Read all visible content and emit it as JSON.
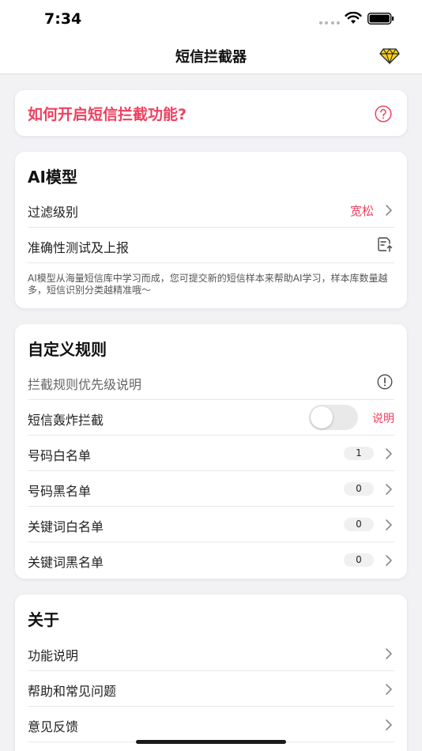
{
  "status_bar": {
    "time": "7:34"
  },
  "navbar": {
    "title": "短信拦截器",
    "premium_icon": "diamond-icon"
  },
  "banner": {
    "text": "如何开启短信拦截功能?",
    "icon": "question-circle-icon"
  },
  "ai_section": {
    "title": "AI模型",
    "rows": [
      {
        "label": "过滤级别",
        "value": "宽松"
      },
      {
        "label": "准确性测试及上报",
        "icon": "report-upload-icon"
      }
    ],
    "note": "AI模型从海量短信库中学习而成，您可提交新的短信样本来帮助AI学习，样本库数量越多，短信识别分类越精准哦～"
  },
  "custom_section": {
    "title": "自定义规则",
    "rows": [
      {
        "label": "拦截规则优先级说明",
        "icon": "info-circle-icon"
      },
      {
        "label": "短信轰炸拦截",
        "toggle_on": false,
        "link": "说明"
      },
      {
        "label": "号码白名单",
        "count": "1"
      },
      {
        "label": "号码黑名单",
        "count": "0"
      },
      {
        "label": "关键词白名单",
        "count": "0"
      },
      {
        "label": "关键词黑名单",
        "count": "0"
      }
    ]
  },
  "about_section": {
    "title": "关于",
    "rows": [
      {
        "label": "功能说明"
      },
      {
        "label": "帮助和常见问题"
      },
      {
        "label": "意见反馈"
      }
    ]
  },
  "colors": {
    "accent_red": "#f04060",
    "background": "#f2f2f4"
  }
}
